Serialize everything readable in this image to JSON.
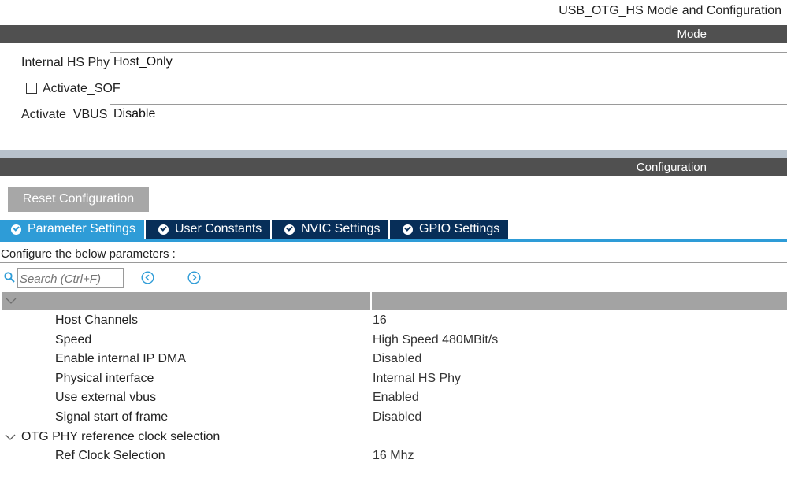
{
  "header": {
    "title": "USB_OTG_HS Mode and Configuration"
  },
  "mode_section": {
    "bar_label": "Mode",
    "internal_hs_phy": {
      "label": "Internal HS Phy",
      "value": "Host_Only"
    },
    "activate_sof": {
      "label": "Activate_SOF",
      "checked": false
    },
    "activate_vbus": {
      "label": "Activate_VBUS",
      "value": "Disable"
    }
  },
  "configuration_section": {
    "bar_label": "Configuration",
    "reset_button": "Reset Configuration",
    "tabs": [
      {
        "label": "Parameter Settings",
        "active": true
      },
      {
        "label": "User Constants",
        "active": false
      },
      {
        "label": "NVIC Settings",
        "active": false
      },
      {
        "label": "GPIO Settings",
        "active": false
      }
    ],
    "instructions": "Configure the below parameters :",
    "search": {
      "placeholder": "Search (Ctrl+F)"
    },
    "parameters": [
      {
        "name": "Host Channels",
        "value": "16"
      },
      {
        "name": "Speed",
        "value": "High Speed 480MBit/s"
      },
      {
        "name": "Enable internal IP DMA",
        "value": "Disabled"
      },
      {
        "name": "Physical interface",
        "value": "Internal HS Phy"
      },
      {
        "name": "Use external vbus",
        "value": "Enabled"
      },
      {
        "name": "Signal start of frame",
        "value": "Disabled"
      }
    ],
    "group": {
      "label": "OTG PHY reference clock selection",
      "parameters": [
        {
          "name": "Ref Clock Selection",
          "value": "16 Mhz"
        }
      ]
    }
  },
  "colors": {
    "tab_active": "#2e9cd7",
    "tab_inactive": "#072e58",
    "section_bar": "#505050",
    "nav_icon": "#2e9cd7"
  }
}
